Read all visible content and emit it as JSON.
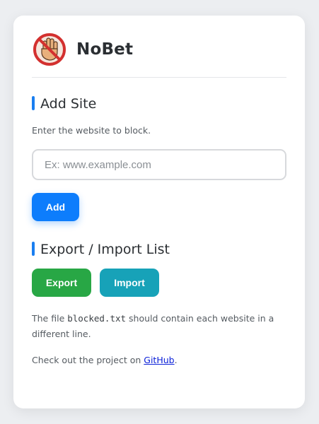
{
  "app": {
    "title": "NoBet",
    "logo_icon": "no-gambling-hand-icon"
  },
  "add_site": {
    "title": "Add Site",
    "description": "Enter the website to block.",
    "placeholder": "Ex: www.example.com",
    "value": "",
    "add_label": "Add"
  },
  "export_import": {
    "title": "Export / Import List",
    "export_label": "Export",
    "import_label": "Import"
  },
  "note": {
    "prefix": "The file ",
    "filename": "blocked.txt",
    "suffix": " should contain each website in a different line."
  },
  "footer": {
    "prefix": "Check out the project on ",
    "link_label": "GitHub",
    "suffix": "."
  },
  "colors": {
    "accent": "#1a7ef0",
    "add_button": "#0d7dfc",
    "export_button": "#28a745",
    "import_button": "#17a2b8",
    "link": "#0b20d8"
  }
}
